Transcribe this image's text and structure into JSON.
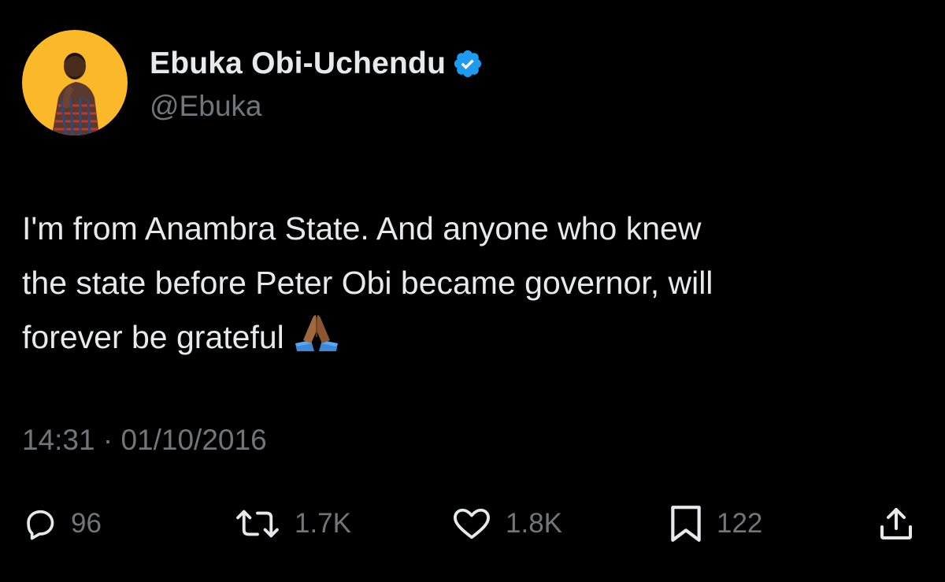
{
  "author": {
    "display_name": "Ebuka Obi-Uchendu",
    "handle": "@Ebuka",
    "verified": true,
    "avatar_background": "#fbb829"
  },
  "tweet": {
    "text": "I'm from Anambra State. And anyone who knew\nthe state before Peter Obi became governor, will\nforever be grateful",
    "emoji": "folded-hands",
    "timestamp": "14:31 · 01/10/2016"
  },
  "actions": {
    "replies": "96",
    "retweets": "1.7K",
    "likes": "1.8K",
    "bookmarks": "122"
  },
  "colors": {
    "background": "#000000",
    "primary_text": "#e7e9ea",
    "secondary_text": "#71767b",
    "verified_blue": "#1d9bf0"
  }
}
